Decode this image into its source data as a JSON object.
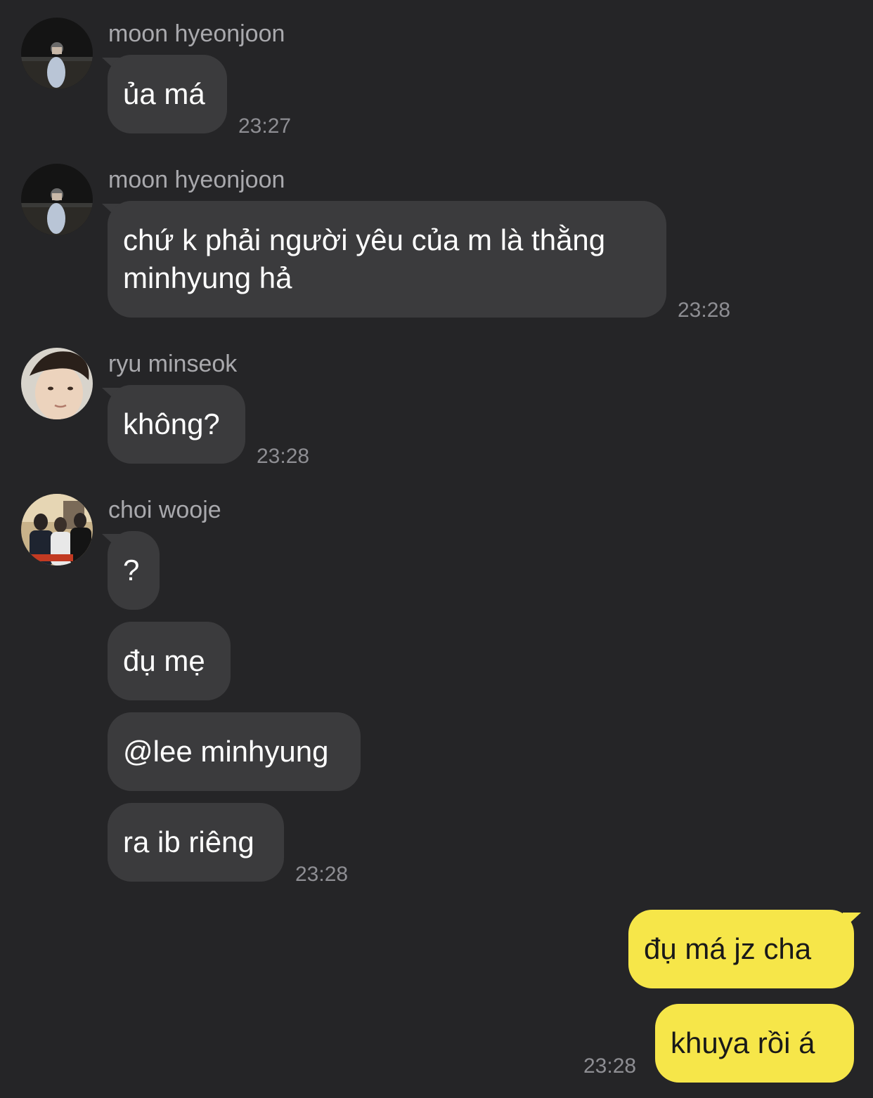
{
  "chat": {
    "groups": [
      {
        "sender": "moon hyeonjoon",
        "avatar": "avatar-night-beach-photo",
        "messages": [
          "ủa má"
        ],
        "time": "23:27"
      },
      {
        "sender": "moon hyeonjoon",
        "avatar": "avatar-night-beach-photo",
        "messages": [
          "chứ k phải người yêu của m là thằng minhyung hả"
        ],
        "time": "23:28"
      },
      {
        "sender": "ryu minseok",
        "avatar": "avatar-selfie-photo",
        "messages": [
          "không?"
        ],
        "time": "23:28"
      },
      {
        "sender": "choi wooje",
        "avatar": "avatar-group-photo",
        "messages": [
          "?",
          "đụ mẹ",
          "@lee minhyung",
          "ra ib riêng"
        ],
        "time": "23:28"
      }
    ],
    "own": {
      "messages": [
        "đụ má jz cha",
        "khuya rồi á"
      ],
      "time": "23:28"
    }
  },
  "colors": {
    "background": "#252527",
    "incoming_bubble": "#3b3b3d",
    "outgoing_bubble": "#f6e649",
    "sender_name": "#a9a9ad",
    "timestamp": "#8e8e93"
  }
}
